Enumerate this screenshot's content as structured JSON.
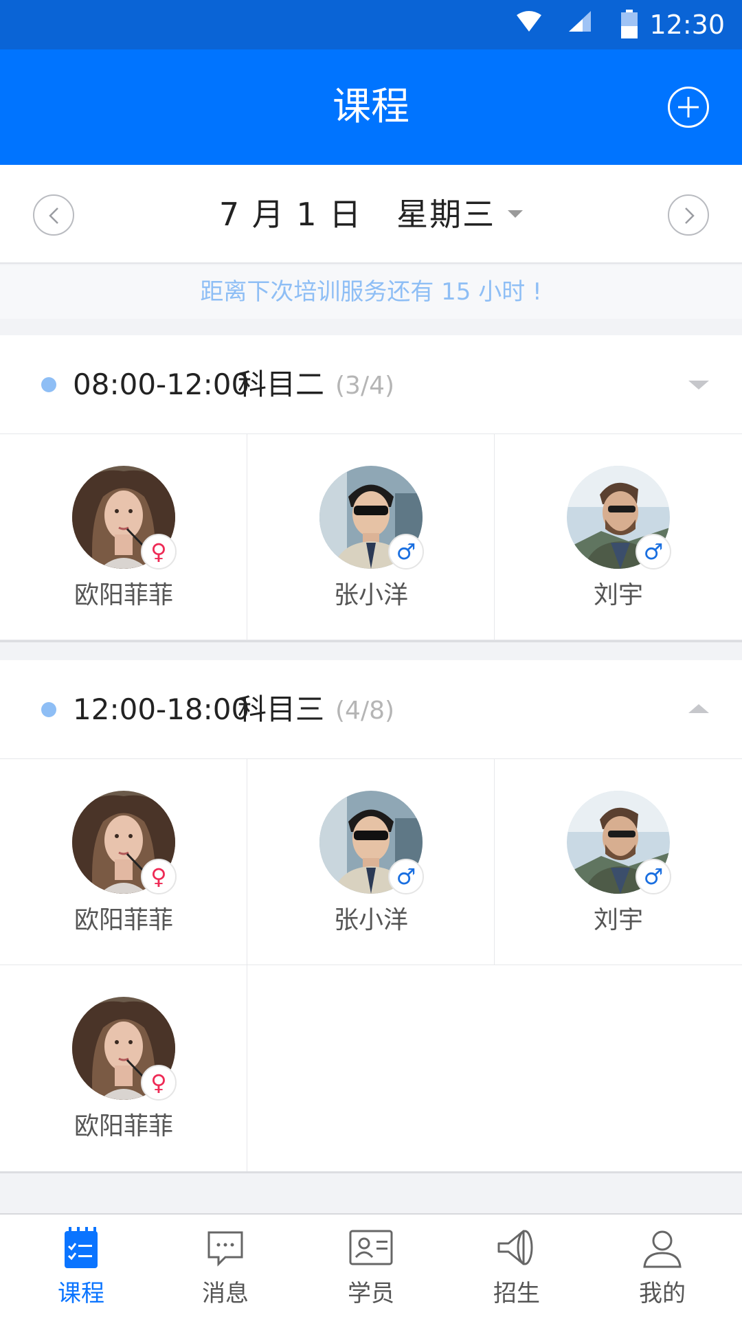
{
  "status_bar": {
    "time": "12:30"
  },
  "app_bar": {
    "title": "课程"
  },
  "date_bar": {
    "date_label": "7 月 1 日   星期三"
  },
  "notice": {
    "text": "距离下次培训服务还有 15 小时 !"
  },
  "sessions": [
    {
      "time": "08:00-12:00",
      "subject": "科目二",
      "count": "(3/4)",
      "expanded": false,
      "students": [
        {
          "name": "欧阳菲菲",
          "gender_symbol": "♀",
          "avatar": "female-student"
        },
        {
          "name": "张小洋",
          "gender_symbol": "♂",
          "avatar": "male-student-sunglasses"
        },
        {
          "name": "刘宇",
          "gender_symbol": "♂",
          "avatar": "male-student-beard"
        }
      ]
    },
    {
      "time": "12:00-18:00",
      "subject": "科目三",
      "count": "(4/8)",
      "expanded": true,
      "students": [
        {
          "name": "欧阳菲菲",
          "gender_symbol": "♀",
          "avatar": "female-student"
        },
        {
          "name": "张小洋",
          "gender_symbol": "♂",
          "avatar": "male-student-sunglasses"
        },
        {
          "name": "刘宇",
          "gender_symbol": "♂",
          "avatar": "male-student-beard"
        },
        {
          "name": "欧阳菲菲",
          "gender_symbol": "♀",
          "avatar": "female-student"
        }
      ]
    }
  ],
  "tab_bar": {
    "items": [
      {
        "label": "课程",
        "icon": "calendar-checklist-icon",
        "active": true
      },
      {
        "label": "消息",
        "icon": "chat-bubble-icon",
        "active": false
      },
      {
        "label": "学员",
        "icon": "id-card-icon",
        "active": false
      },
      {
        "label": "招生",
        "icon": "megaphone-icon",
        "active": false
      },
      {
        "label": "我的",
        "icon": "person-icon",
        "active": false
      }
    ]
  },
  "colors": {
    "primary": "#0074FF",
    "status_bar": "#0A64D6",
    "accent_light": "#8EBEF5",
    "female": "#EE2A55",
    "male": "#1A6FE0"
  }
}
